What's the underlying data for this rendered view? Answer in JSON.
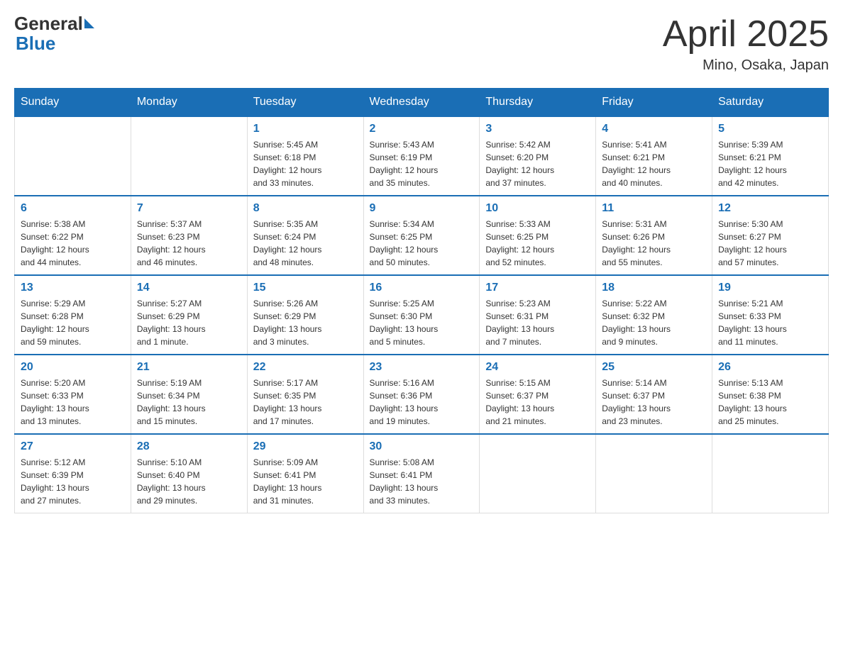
{
  "header": {
    "logo_general": "General",
    "logo_blue": "Blue",
    "main_title": "April 2025",
    "subtitle": "Mino, Osaka, Japan"
  },
  "calendar": {
    "days_of_week": [
      "Sunday",
      "Monday",
      "Tuesday",
      "Wednesday",
      "Thursday",
      "Friday",
      "Saturday"
    ],
    "weeks": [
      [
        {
          "day": "",
          "info": ""
        },
        {
          "day": "",
          "info": ""
        },
        {
          "day": "1",
          "info": "Sunrise: 5:45 AM\nSunset: 6:18 PM\nDaylight: 12 hours\nand 33 minutes."
        },
        {
          "day": "2",
          "info": "Sunrise: 5:43 AM\nSunset: 6:19 PM\nDaylight: 12 hours\nand 35 minutes."
        },
        {
          "day": "3",
          "info": "Sunrise: 5:42 AM\nSunset: 6:20 PM\nDaylight: 12 hours\nand 37 minutes."
        },
        {
          "day": "4",
          "info": "Sunrise: 5:41 AM\nSunset: 6:21 PM\nDaylight: 12 hours\nand 40 minutes."
        },
        {
          "day": "5",
          "info": "Sunrise: 5:39 AM\nSunset: 6:21 PM\nDaylight: 12 hours\nand 42 minutes."
        }
      ],
      [
        {
          "day": "6",
          "info": "Sunrise: 5:38 AM\nSunset: 6:22 PM\nDaylight: 12 hours\nand 44 minutes."
        },
        {
          "day": "7",
          "info": "Sunrise: 5:37 AM\nSunset: 6:23 PM\nDaylight: 12 hours\nand 46 minutes."
        },
        {
          "day": "8",
          "info": "Sunrise: 5:35 AM\nSunset: 6:24 PM\nDaylight: 12 hours\nand 48 minutes."
        },
        {
          "day": "9",
          "info": "Sunrise: 5:34 AM\nSunset: 6:25 PM\nDaylight: 12 hours\nand 50 minutes."
        },
        {
          "day": "10",
          "info": "Sunrise: 5:33 AM\nSunset: 6:25 PM\nDaylight: 12 hours\nand 52 minutes."
        },
        {
          "day": "11",
          "info": "Sunrise: 5:31 AM\nSunset: 6:26 PM\nDaylight: 12 hours\nand 55 minutes."
        },
        {
          "day": "12",
          "info": "Sunrise: 5:30 AM\nSunset: 6:27 PM\nDaylight: 12 hours\nand 57 minutes."
        }
      ],
      [
        {
          "day": "13",
          "info": "Sunrise: 5:29 AM\nSunset: 6:28 PM\nDaylight: 12 hours\nand 59 minutes."
        },
        {
          "day": "14",
          "info": "Sunrise: 5:27 AM\nSunset: 6:29 PM\nDaylight: 13 hours\nand 1 minute."
        },
        {
          "day": "15",
          "info": "Sunrise: 5:26 AM\nSunset: 6:29 PM\nDaylight: 13 hours\nand 3 minutes."
        },
        {
          "day": "16",
          "info": "Sunrise: 5:25 AM\nSunset: 6:30 PM\nDaylight: 13 hours\nand 5 minutes."
        },
        {
          "day": "17",
          "info": "Sunrise: 5:23 AM\nSunset: 6:31 PM\nDaylight: 13 hours\nand 7 minutes."
        },
        {
          "day": "18",
          "info": "Sunrise: 5:22 AM\nSunset: 6:32 PM\nDaylight: 13 hours\nand 9 minutes."
        },
        {
          "day": "19",
          "info": "Sunrise: 5:21 AM\nSunset: 6:33 PM\nDaylight: 13 hours\nand 11 minutes."
        }
      ],
      [
        {
          "day": "20",
          "info": "Sunrise: 5:20 AM\nSunset: 6:33 PM\nDaylight: 13 hours\nand 13 minutes."
        },
        {
          "day": "21",
          "info": "Sunrise: 5:19 AM\nSunset: 6:34 PM\nDaylight: 13 hours\nand 15 minutes."
        },
        {
          "day": "22",
          "info": "Sunrise: 5:17 AM\nSunset: 6:35 PM\nDaylight: 13 hours\nand 17 minutes."
        },
        {
          "day": "23",
          "info": "Sunrise: 5:16 AM\nSunset: 6:36 PM\nDaylight: 13 hours\nand 19 minutes."
        },
        {
          "day": "24",
          "info": "Sunrise: 5:15 AM\nSunset: 6:37 PM\nDaylight: 13 hours\nand 21 minutes."
        },
        {
          "day": "25",
          "info": "Sunrise: 5:14 AM\nSunset: 6:37 PM\nDaylight: 13 hours\nand 23 minutes."
        },
        {
          "day": "26",
          "info": "Sunrise: 5:13 AM\nSunset: 6:38 PM\nDaylight: 13 hours\nand 25 minutes."
        }
      ],
      [
        {
          "day": "27",
          "info": "Sunrise: 5:12 AM\nSunset: 6:39 PM\nDaylight: 13 hours\nand 27 minutes."
        },
        {
          "day": "28",
          "info": "Sunrise: 5:10 AM\nSunset: 6:40 PM\nDaylight: 13 hours\nand 29 minutes."
        },
        {
          "day": "29",
          "info": "Sunrise: 5:09 AM\nSunset: 6:41 PM\nDaylight: 13 hours\nand 31 minutes."
        },
        {
          "day": "30",
          "info": "Sunrise: 5:08 AM\nSunset: 6:41 PM\nDaylight: 13 hours\nand 33 minutes."
        },
        {
          "day": "",
          "info": ""
        },
        {
          "day": "",
          "info": ""
        },
        {
          "day": "",
          "info": ""
        }
      ]
    ]
  }
}
